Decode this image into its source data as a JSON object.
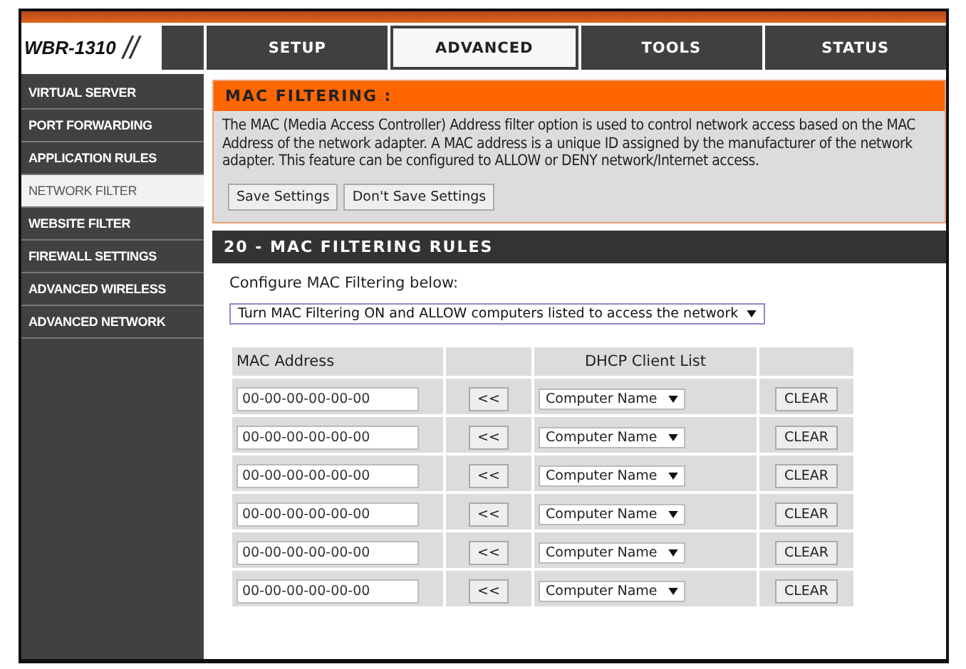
{
  "logo": {
    "model": "WBR-1310",
    "slashes": "//"
  },
  "tabs": [
    {
      "label": "SETUP",
      "selected": false
    },
    {
      "label": "ADVANCED",
      "selected": true
    },
    {
      "label": "TOOLS",
      "selected": false
    },
    {
      "label": "STATUS",
      "selected": false
    }
  ],
  "sidebar": {
    "items": [
      {
        "label": "VIRTUAL SERVER",
        "selected": false
      },
      {
        "label": "PORT FORWARDING",
        "selected": false
      },
      {
        "label": "APPLICATION RULES",
        "selected": false
      },
      {
        "label": "NETWORK FILTER",
        "selected": true
      },
      {
        "label": "WEBSITE FILTER",
        "selected": false
      },
      {
        "label": "FIREWALL SETTINGS",
        "selected": false
      },
      {
        "label": "ADVANCED WIRELESS",
        "selected": false
      },
      {
        "label": "ADVANCED NETWORK",
        "selected": false
      }
    ]
  },
  "intro": {
    "title": "MAC FILTERING :",
    "description": "The MAC (Media Access Controller) Address filter option is used to control network access based on the MAC Address of the network adapter. A MAC address is a unique ID assigned by the manufacturer of the network adapter. This feature can be configured to ALLOW or DENY network/Internet access.",
    "buttons": [
      "Save Settings",
      "Don't Save Settings"
    ]
  },
  "rules": {
    "title": "20 - MAC FILTERING RULES",
    "configure_label": "Configure MAC Filtering below:",
    "mode_select": "Turn MAC Filtering ON and ALLOW computers listed to access the network",
    "columns": [
      "MAC Address",
      "DHCP Client List"
    ],
    "rows": [
      {
        "mac": "00-00-00-00-00-00",
        "copy": "<<",
        "client": "Computer Name",
        "clear": "CLEAR"
      },
      {
        "mac": "00-00-00-00-00-00",
        "copy": "<<",
        "client": "Computer Name",
        "clear": "CLEAR"
      },
      {
        "mac": "00-00-00-00-00-00",
        "copy": "<<",
        "client": "Computer Name",
        "clear": "CLEAR"
      },
      {
        "mac": "00-00-00-00-00-00",
        "copy": "<<",
        "client": "Computer Name",
        "clear": "CLEAR"
      },
      {
        "mac": "00-00-00-00-00-00",
        "copy": "<<",
        "client": "Computer Name",
        "clear": "CLEAR"
      },
      {
        "mac": "00-00-00-00-00-00",
        "copy": "<<",
        "client": "Computer Name",
        "clear": "CLEAR"
      }
    ]
  }
}
